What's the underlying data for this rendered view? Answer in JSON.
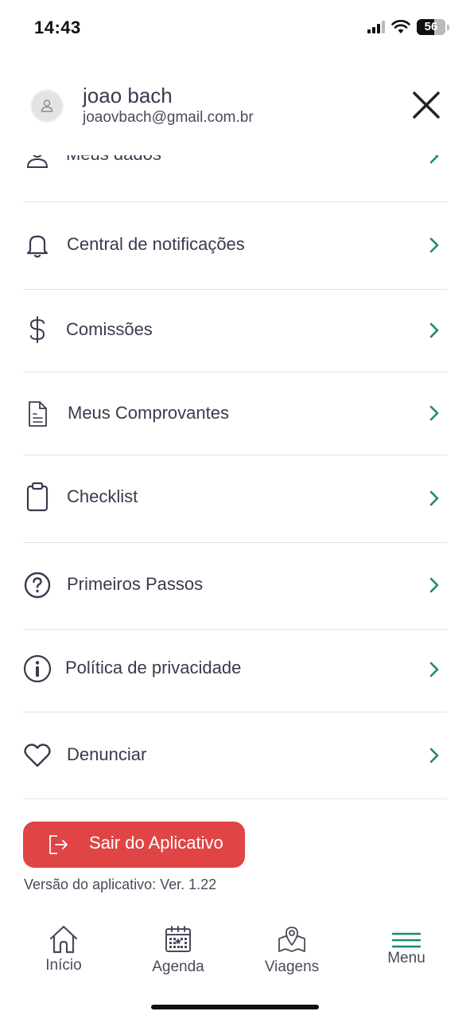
{
  "status_bar": {
    "time": "14:43",
    "battery": "56"
  },
  "profile": {
    "name": "joao bach",
    "email": "joaovbach@gmail.com.br"
  },
  "menu": {
    "items": [
      {
        "label": "Meus dados",
        "icon": "user-icon"
      },
      {
        "label": "Central de notificações",
        "icon": "bell-icon"
      },
      {
        "label": "Comissões",
        "icon": "dollar-icon"
      },
      {
        "label": "Meus Comprovantes",
        "icon": "document-icon"
      },
      {
        "label": "Checklist",
        "icon": "clipboard-icon"
      },
      {
        "label": "Primeiros Passos",
        "icon": "question-icon"
      },
      {
        "label": "Política de privacidade",
        "icon": "info-icon"
      },
      {
        "label": "Denunciar",
        "icon": "heart-icon"
      }
    ]
  },
  "logout": {
    "label": "Sair do Aplicativo"
  },
  "version": {
    "text": "Versão do aplicativo: Ver. 1.22"
  },
  "tabbar": {
    "tabs": [
      {
        "label": "Início",
        "icon": "home-icon"
      },
      {
        "label": "Agenda",
        "icon": "calendar-icon"
      },
      {
        "label": "Viagens",
        "icon": "map-pin-icon"
      },
      {
        "label": "Menu",
        "icon": "menu-icon"
      }
    ]
  },
  "colors": {
    "accent": "#1a8a6a",
    "danger": "#e04444",
    "text": "#3a3a4e"
  }
}
